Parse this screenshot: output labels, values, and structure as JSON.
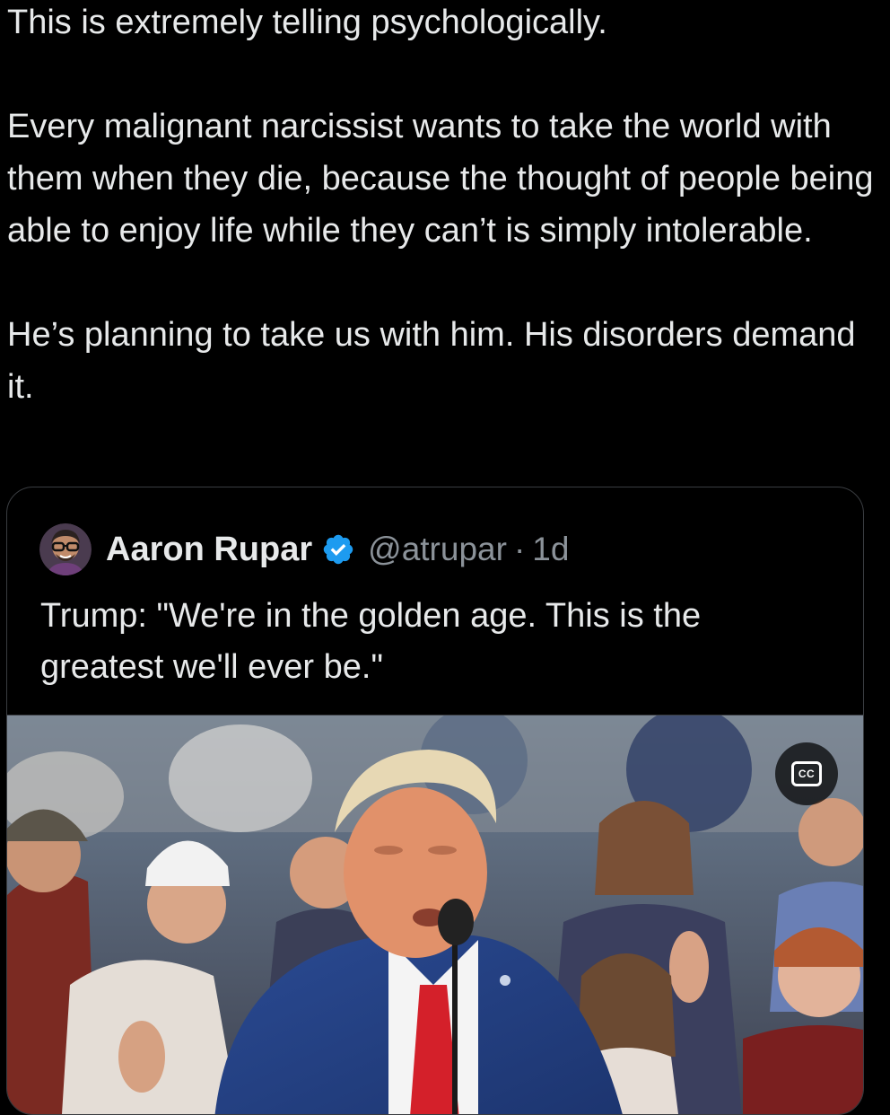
{
  "tweet": {
    "paragraphs": [
      "This is extremely telling psychologically.",
      "Every malignant narcissist wants to take the world with them when they die, because the thought of people being able to enjoy life while they can’t is simply intolerable.",
      "He’s planning to take us with him. His disorders demand it."
    ]
  },
  "quoted_post": {
    "author_name": "Aaron Rupar",
    "verified": true,
    "handle": "@atrupar",
    "separator": "·",
    "age": "1d",
    "text": "Trump: \"We're in the golden age. This is the greatest we'll ever be.\"",
    "media": {
      "type": "video",
      "cc_label": "CC"
    }
  },
  "icons": {
    "verified": "verified-badge-icon",
    "captions": "closed-captions-icon"
  },
  "colors": {
    "background": "#000000",
    "text": "#e7e9ea",
    "secondary_text": "#8b9299",
    "verified_blue": "#1d9bf0",
    "card_border": "#3a3d41"
  }
}
